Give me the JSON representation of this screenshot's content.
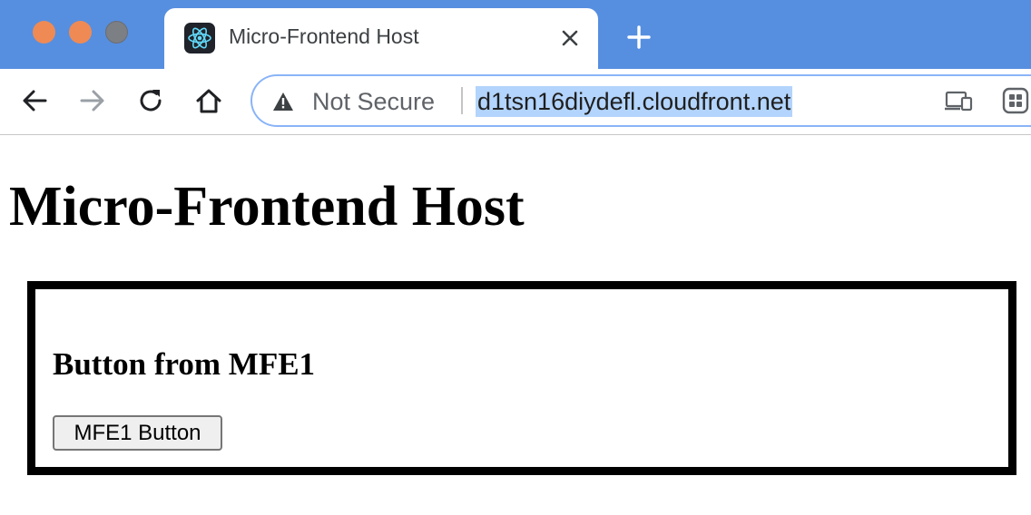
{
  "browser": {
    "window_controls": [
      "close",
      "minimize",
      "maximize"
    ],
    "tab": {
      "title": "Micro-Frontend Host",
      "favicon": "react-icon"
    },
    "toolbar": {
      "security_label": "Not Secure",
      "url": "d1tsn16diydefl.cloudfront.net"
    },
    "colors": {
      "titlebar": "#568fe0",
      "traffic_close": "#ef8a54",
      "traffic_minimize": "#ef8a54",
      "traffic_maximize": "#7c7f84",
      "url_selection": "#b3d4fc"
    }
  },
  "page": {
    "title": "Micro-Frontend Host",
    "mfe1": {
      "heading": "Button from MFE1",
      "button_label": "MFE1 Button"
    }
  }
}
